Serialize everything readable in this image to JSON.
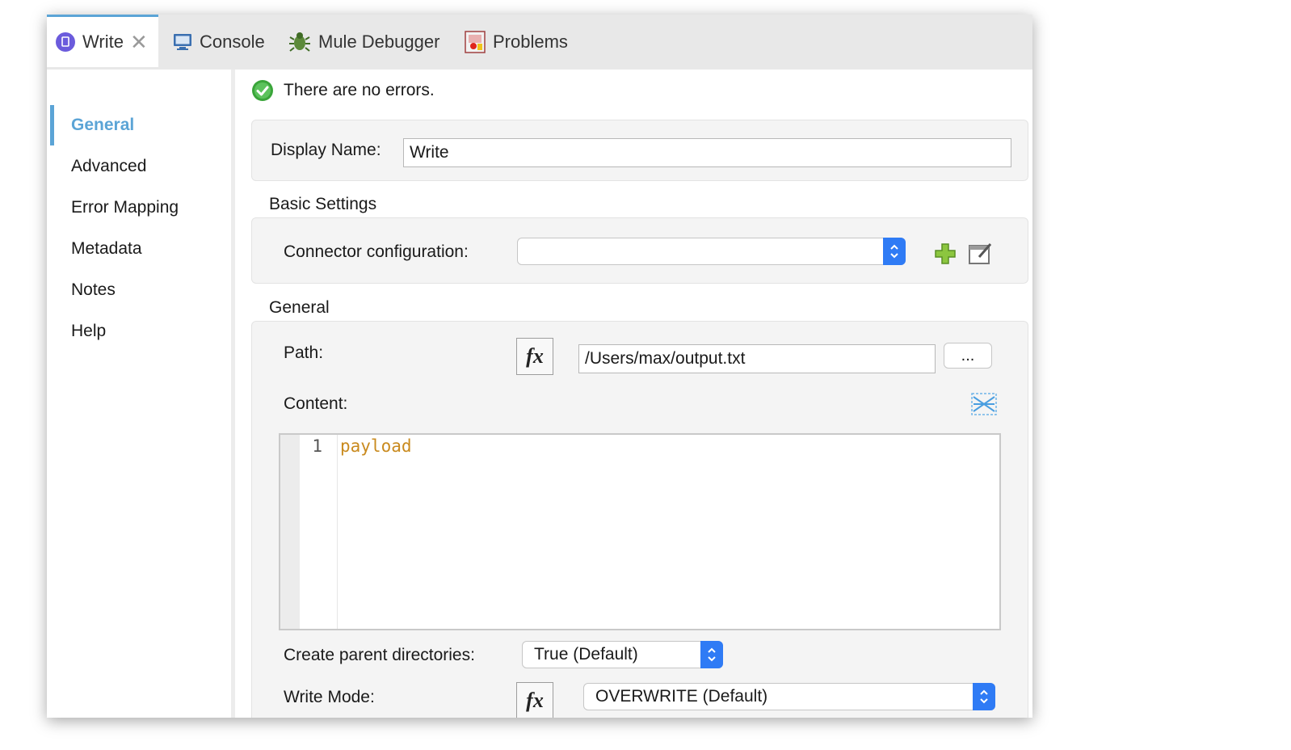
{
  "tabs": [
    {
      "label": "Write",
      "active": true,
      "icon": "write-doc-icon"
    },
    {
      "label": "Console",
      "icon": "console-monitor-icon"
    },
    {
      "label": "Mule Debugger",
      "icon": "bug-icon"
    },
    {
      "label": "Problems",
      "icon": "problems-icon"
    }
  ],
  "sidebar": {
    "items": [
      {
        "label": "General",
        "active": true
      },
      {
        "label": "Advanced"
      },
      {
        "label": "Error Mapping"
      },
      {
        "label": "Metadata"
      },
      {
        "label": "Notes"
      },
      {
        "label": "Help"
      }
    ]
  },
  "status": {
    "message": "There are no errors.",
    "icon": "check-circle-icon"
  },
  "display_name": {
    "label": "Display Name:",
    "value": "Write"
  },
  "basic_settings": {
    "title": "Basic Settings",
    "connector_label": "Connector configuration:",
    "connector_value": ""
  },
  "general": {
    "title": "General",
    "path_label": "Path:",
    "path_value": "/Users/max/output.txt",
    "browse_label": "...",
    "fx_label": "fx",
    "content_label": "Content:",
    "content_lines": [
      {
        "num": "1",
        "code": "payload"
      }
    ],
    "create_parent_label": "Create parent directories:",
    "create_parent_value": "True (Default)",
    "write_mode_label": "Write Mode:",
    "write_mode_value": "OVERWRITE (Default)"
  },
  "colors": {
    "accent": "#5ba4d6",
    "select_blue": "#2f7bf5",
    "code": "#c98a1e",
    "ok_green": "#3aa53a"
  }
}
